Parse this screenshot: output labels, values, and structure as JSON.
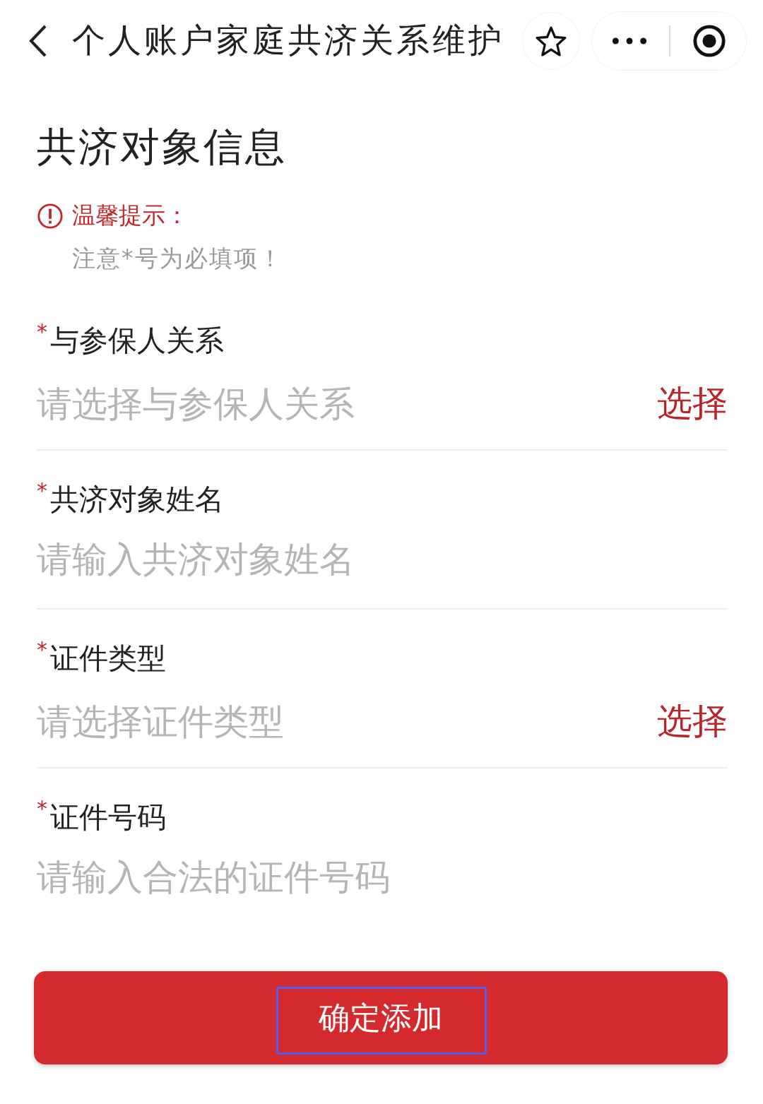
{
  "nav": {
    "title": "个人账户家庭共济关系维护"
  },
  "section_title": "共济对象信息",
  "tip": {
    "title": "温馨提示：",
    "text": "注意*号为必填项！"
  },
  "fields": [
    {
      "kind": "select",
      "required_mark": "*",
      "label": "与参保人关系",
      "placeholder": "请选择与参保人关系",
      "action": "选择"
    },
    {
      "kind": "text",
      "required_mark": "*",
      "label": "共济对象姓名",
      "placeholder": "请输入共济对象姓名"
    },
    {
      "kind": "select",
      "required_mark": "*",
      "label": "证件类型",
      "placeholder": "请选择证件类型",
      "action": "选择"
    },
    {
      "kind": "text",
      "required_mark": "*",
      "label": "证件号码",
      "placeholder": "请输入合法的证件号码"
    }
  ],
  "submit": {
    "label": "确定添加",
    "highlighted": true
  }
}
